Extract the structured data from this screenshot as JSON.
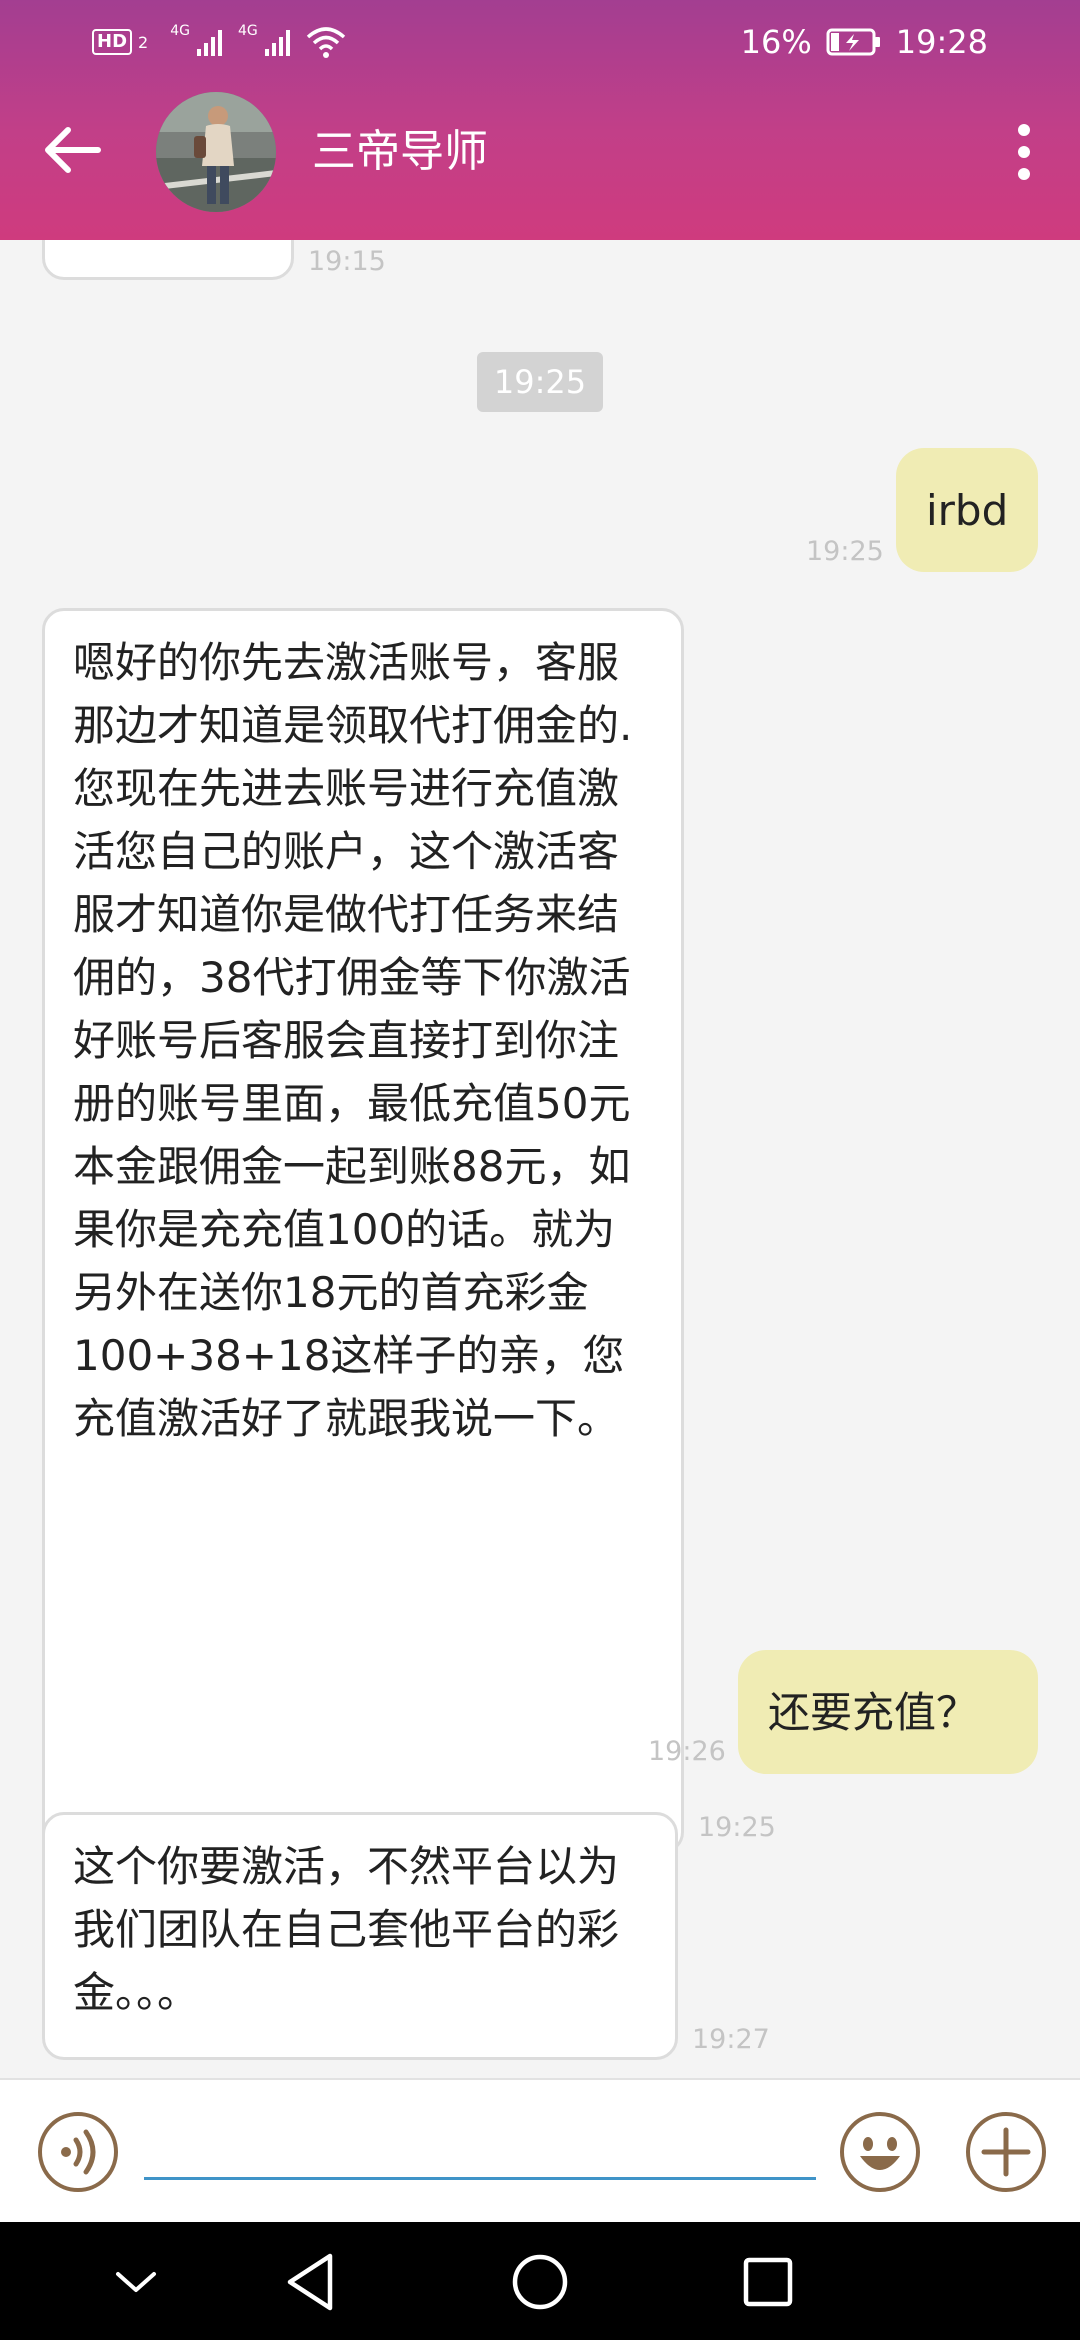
{
  "status_bar": {
    "hd": "HD",
    "sim_slot": "2",
    "net1": "4G",
    "net2": "4G",
    "battery": "16%",
    "time": "19:28"
  },
  "header": {
    "contact_name": "三帝导师",
    "icons": [
      "back-arrow-icon",
      "avatar",
      "more-vertical-icon"
    ]
  },
  "chat": {
    "prev_time": "19:15",
    "center_time": "19:25",
    "messages": [
      {
        "side": "out",
        "text": "irbd",
        "time": "19:25"
      },
      {
        "side": "in",
        "text": "嗯好的你先去激活账号，客服那边才知道是领取代打佣金的.您现在先进去账号进行充值激活您自己的账户，这个激活客服才知道你是做代打任务来结佣的，38代打佣金等下你激活好账号后客服会直接打到你注册的账号里面，最低充值50元本金跟佣金一起到账88元，如果你是充充值100的话。就为另外在送你18元的首充彩金100+38+18这样子的亲，您充值激活好了就跟我说一下。",
        "time": "19:25"
      },
      {
        "side": "out",
        "text": "还要充值？",
        "time": "19:26"
      },
      {
        "side": "in",
        "text": "这个你要激活，不然平台以为我们团队在自己套他平台的彩金。。。",
        "time": "19:27"
      }
    ]
  },
  "input_bar": {
    "value": "",
    "icons": [
      "voice-icon",
      "emoji-icon",
      "plus-icon"
    ]
  },
  "colors": {
    "header_top": "#a33e91",
    "header_bottom": "#cf3b7e",
    "outgoing_bubble": "#f0ecb4",
    "incoming_bubble": "#ffffff",
    "input_underline": "#3f94c8",
    "icon_brown": "#8a6a4a"
  }
}
